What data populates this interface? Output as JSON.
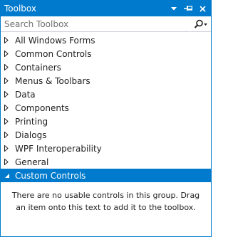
{
  "window": {
    "title": "Toolbox",
    "colors": {
      "accent": "#007acc",
      "background": "#ffffff",
      "text": "#1e1e1e"
    },
    "icons": [
      "dropdown-arrow-icon",
      "pin-icon",
      "close-icon"
    ]
  },
  "search": {
    "placeholder": "Search Toolbox",
    "value": "",
    "icon": "search-icon"
  },
  "groups": [
    {
      "label": "All Windows Forms",
      "expanded": false
    },
    {
      "label": "Common Controls",
      "expanded": false
    },
    {
      "label": "Containers",
      "expanded": false
    },
    {
      "label": "Menus & Toolbars",
      "expanded": false
    },
    {
      "label": "Data",
      "expanded": false
    },
    {
      "label": "Components",
      "expanded": false
    },
    {
      "label": "Printing",
      "expanded": false
    },
    {
      "label": "Dialogs",
      "expanded": false
    },
    {
      "label": "WPF Interoperability",
      "expanded": false
    },
    {
      "label": "General",
      "expanded": false
    },
    {
      "label": "Custom Controls",
      "expanded": true,
      "selected": true
    }
  ],
  "empty_message": "There are no usable controls in this group. Drag an item onto this text to add it to the toolbox."
}
